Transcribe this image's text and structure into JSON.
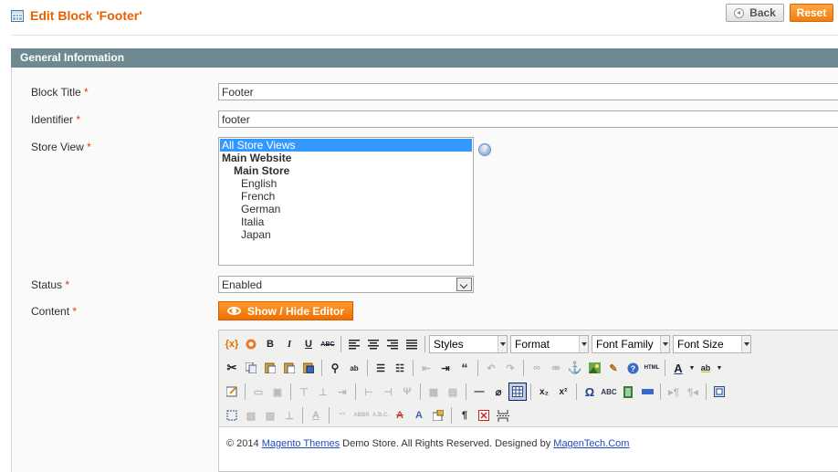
{
  "page": {
    "title": "Edit Block 'Footer'",
    "back_label": "Back",
    "reset_label": "Reset"
  },
  "section": {
    "title": "General Information"
  },
  "form": {
    "block_title": {
      "label": "Block Title",
      "required": "*",
      "value": "Footer"
    },
    "identifier": {
      "label": "Identifier",
      "required": "*",
      "value": "footer"
    },
    "store_view": {
      "label": "Store View",
      "required": "*",
      "options": [
        {
          "text": "All Store Views",
          "selected": true
        },
        {
          "text": "Main Website"
        },
        {
          "text": "Main Store"
        },
        {
          "text": "English"
        },
        {
          "text": "French"
        },
        {
          "text": "German"
        },
        {
          "text": "Italia"
        },
        {
          "text": "Japan"
        }
      ]
    },
    "status": {
      "label": "Status",
      "required": "*",
      "value": "Enabled"
    },
    "content": {
      "label": "Content",
      "required": "*",
      "toggle_label": "Show / Hide Editor"
    }
  },
  "editor": {
    "dropdowns": {
      "styles": "Styles",
      "format": "Format",
      "font_family": "Font Family",
      "font_size": "Font Size"
    },
    "body": {
      "prefix": "© 2014 ",
      "link1": "Magento Themes",
      "middle": " Demo Store. All Rights Reserved. Designed by ",
      "link2": "MagenTech.Com"
    }
  },
  "colors": {
    "accent": "#eb5e00",
    "section_header": "#6f8992",
    "link": "#1e4cc8",
    "selected": "#3399ff"
  }
}
